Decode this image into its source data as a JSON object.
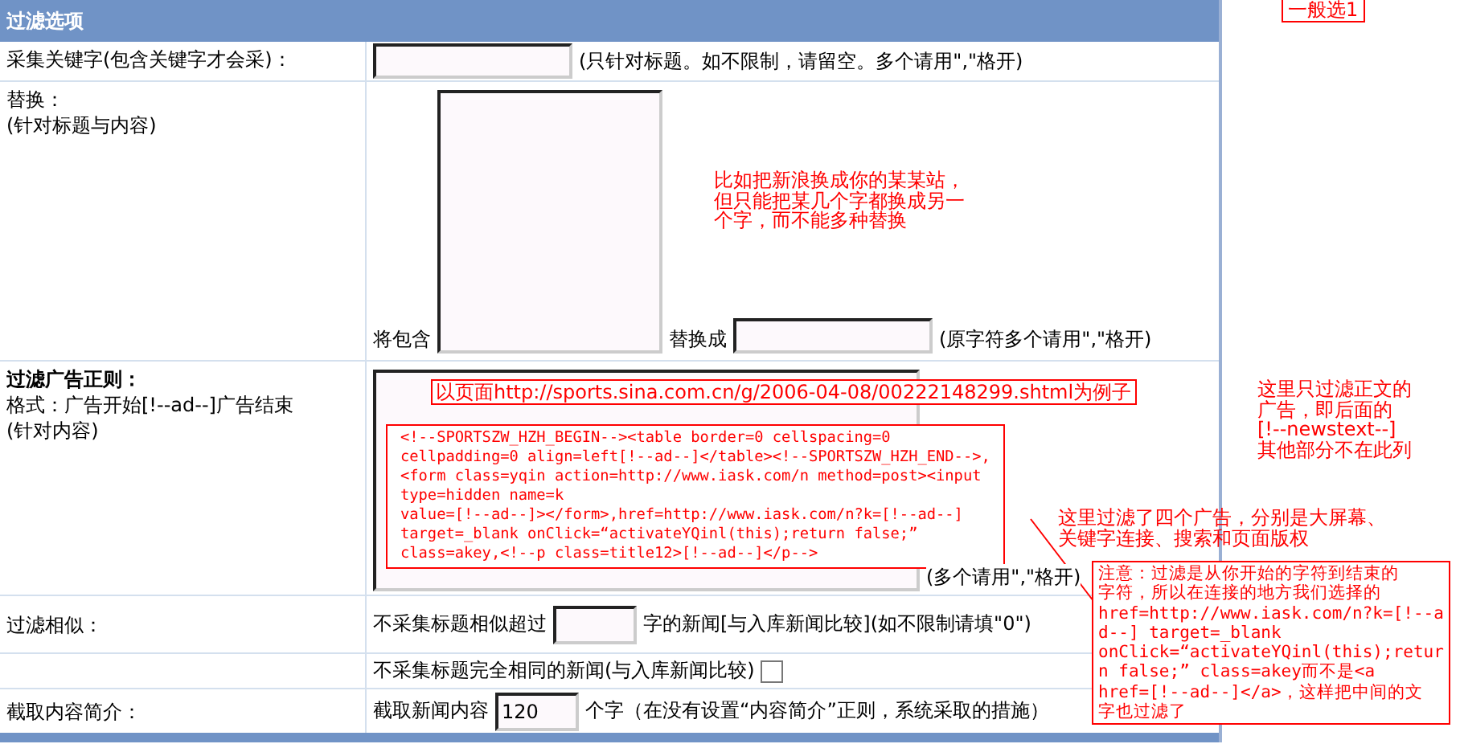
{
  "header": {
    "title": "过滤选项"
  },
  "corner_note": "一般选1",
  "keyword": {
    "label": "采集关键字(包含关键字才会采)：",
    "hint": "(只针对标题。如不限制，请留空。多个请用\",\"格开)"
  },
  "replace": {
    "label": "替换：",
    "sublabel": "(针对标题与内容)",
    "from_label": "将包含",
    "to_label": "替换成",
    "hint": "(原字符多个请用\",\"格开)",
    "note_lines": [
      "比如把新浪换成你的某某站，",
      "但只能把某几个字都换成另一",
      "个字，而不能多种替换"
    ]
  },
  "ad_filter": {
    "label": "过滤广告正则：",
    "format": "格式：广告开始[!--ad--]广告结束",
    "scope": "(针对内容)",
    "hint": "(多个请用\",\"格开)",
    "example_title": "以页面http://sports.sina.com.cn/g/2006-04-08/00222148299.shtml为例子",
    "code_lines": [
      "<!--SPORTSZW_HZH_BEGIN--><table border=0 cellspacing=0",
      "cellpadding=0 align=left[!--ad--]</table><!--SPORTSZW_HZH_END-->,",
      "<form class=yqin action=http://www.iask.com/n method=post><input",
      "type=hidden name=k",
      "value=[!--ad--]></form>,href=http://www.iask.com/n?k=[!--ad--]",
      "target=_blank onClick=“activateYQinl(this);return false;”",
      "class=akey,<!--p class=title12>[!--ad--]</p-->"
    ]
  },
  "side_note_lines": [
    "这里只过滤正文的",
    "广告，即后面的",
    "[!--newstext--]",
    "其他部分不在此列"
  ],
  "ads_note_lines": [
    "这里过滤了四个广告，分别是大屏幕、",
    "关键字连接、搜索和页面版权"
  ],
  "warning_note_lines": [
    "注意：过滤是从你开始的字符到结束的",
    "字符，所以在连接的地方我们选择的",
    "href=http://www.iask.com/n?k=[!--a",
    "d--] target=_blank",
    "onClick=“activateYQinl(this);retur",
    "n false;” class=akey而不是<a",
    "href=[!--ad--]</a>，这样把中间的文",
    "字也过滤了"
  ],
  "similar": {
    "label": "过滤相似：",
    "before": "不采集标题相似超过",
    "after": "字的新闻[与入库新闻比较](如不限制请填\"0\")"
  },
  "exact": {
    "text": "不采集标题完全相同的新闻(与入库新闻比较)",
    "checked": false
  },
  "summary": {
    "label": "截取内容简介：",
    "before": "截取新闻内容",
    "value": "120",
    "after": "个字（在没有设置“内容简介”正则，系统采取的措施）"
  }
}
